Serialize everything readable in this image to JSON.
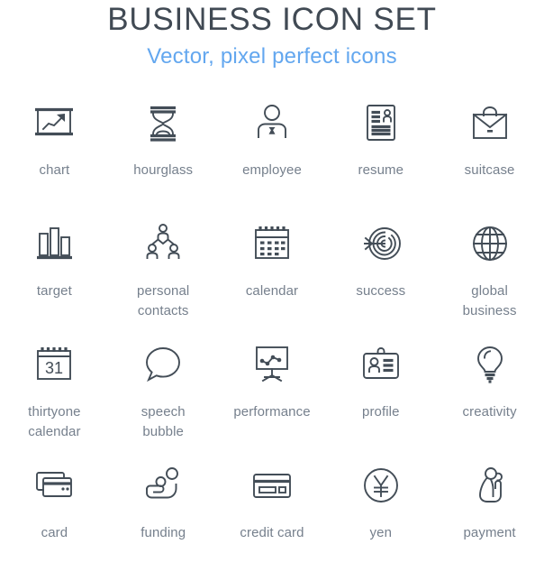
{
  "header": {
    "title": "BUSINESS ICON SET",
    "subtitle": "Vector, pixel perfect icons",
    "title_color": "#414a54",
    "subtitle_color": "#63a7ef"
  },
  "theme": {
    "background": "#ffffff",
    "icon_color": "#434d57",
    "label_color": "#76808d"
  },
  "grid": {
    "columns": 5,
    "rows": 4
  },
  "icons": [
    {
      "name": "chart",
      "label": "chart",
      "icon": "chart-icon"
    },
    {
      "name": "hourglass",
      "label": "hourglass",
      "icon": "hourglass-icon"
    },
    {
      "name": "employee",
      "label": "employee",
      "icon": "employee-icon"
    },
    {
      "name": "resume",
      "label": "resume",
      "icon": "resume-icon"
    },
    {
      "name": "suitcase",
      "label": "suitcase",
      "icon": "suitcase-icon"
    },
    {
      "name": "target",
      "label": "target",
      "icon": "bar-chart-icon"
    },
    {
      "name": "personal-contacts",
      "label": "personal\ncontacts",
      "icon": "org-chart-icon"
    },
    {
      "name": "calendar",
      "label": "calendar",
      "icon": "calendar-icon"
    },
    {
      "name": "success",
      "label": "success",
      "icon": "dartboard-arrow-icon"
    },
    {
      "name": "global-business",
      "label": "global\nbusiness",
      "icon": "globe-icon"
    },
    {
      "name": "thirtyone-calendar",
      "label": "thirtyone\ncalendar",
      "icon": "calendar-31-icon"
    },
    {
      "name": "speech-bubble",
      "label": "speech\nbubble",
      "icon": "speech-bubble-icon"
    },
    {
      "name": "performance",
      "label": "performance",
      "icon": "presentation-chart-icon"
    },
    {
      "name": "profile",
      "label": "profile",
      "icon": "id-badge-icon"
    },
    {
      "name": "creativity",
      "label": "creativity",
      "icon": "lightbulb-icon"
    },
    {
      "name": "card",
      "label": "card",
      "icon": "stacked-cards-icon"
    },
    {
      "name": "funding",
      "label": "funding",
      "icon": "hand-coin-icon"
    },
    {
      "name": "credit-card",
      "label": "credit card",
      "icon": "credit-card-icon"
    },
    {
      "name": "yen",
      "label": "yen",
      "icon": "yen-coin-icon"
    },
    {
      "name": "payment",
      "label": "payment",
      "icon": "hand-tap-icon"
    }
  ]
}
